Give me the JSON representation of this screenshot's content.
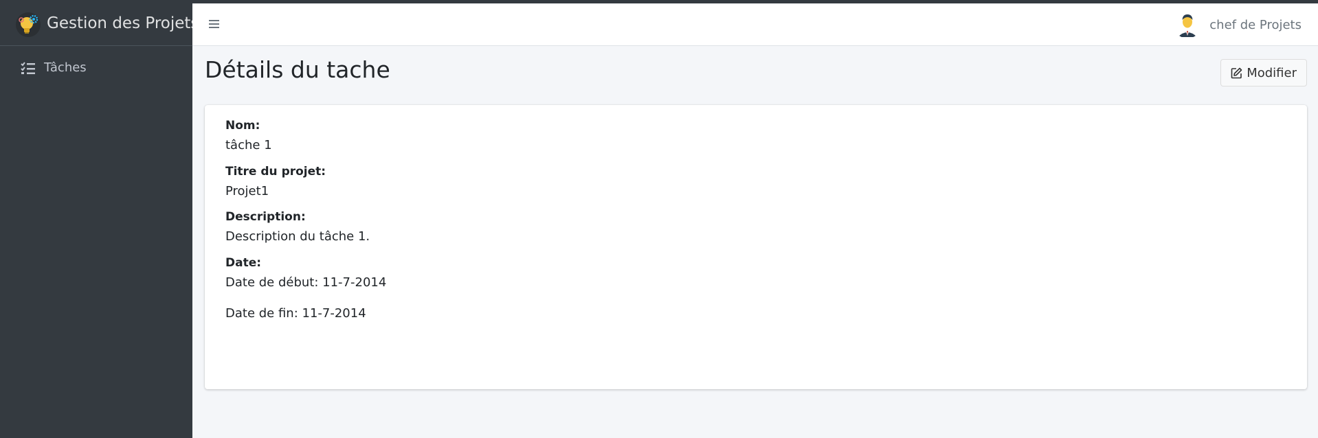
{
  "app": {
    "brand": "Gestion des Projets"
  },
  "sidebar": {
    "items": [
      {
        "label": "Tâches",
        "icon": "tasks-icon"
      }
    ]
  },
  "header": {
    "user_name": "chef de Projets"
  },
  "page": {
    "title": "Détails du tache",
    "edit_label": "Modifier"
  },
  "details": {
    "name_label": "Nom:",
    "name_value": "tâche 1",
    "project_label": "Titre du projet:",
    "project_value": "Projet1",
    "description_label": "Description:",
    "description_value": "Description du tâche 1.",
    "date_label": "Date:",
    "start_date": "Date de début: 11-7-2014",
    "end_date": "Date de fin: 11-7-2014"
  },
  "colors": {
    "sidebar_bg": "#343a40",
    "content_bg": "#f4f6f9",
    "brand_accent": "#f4c542"
  }
}
